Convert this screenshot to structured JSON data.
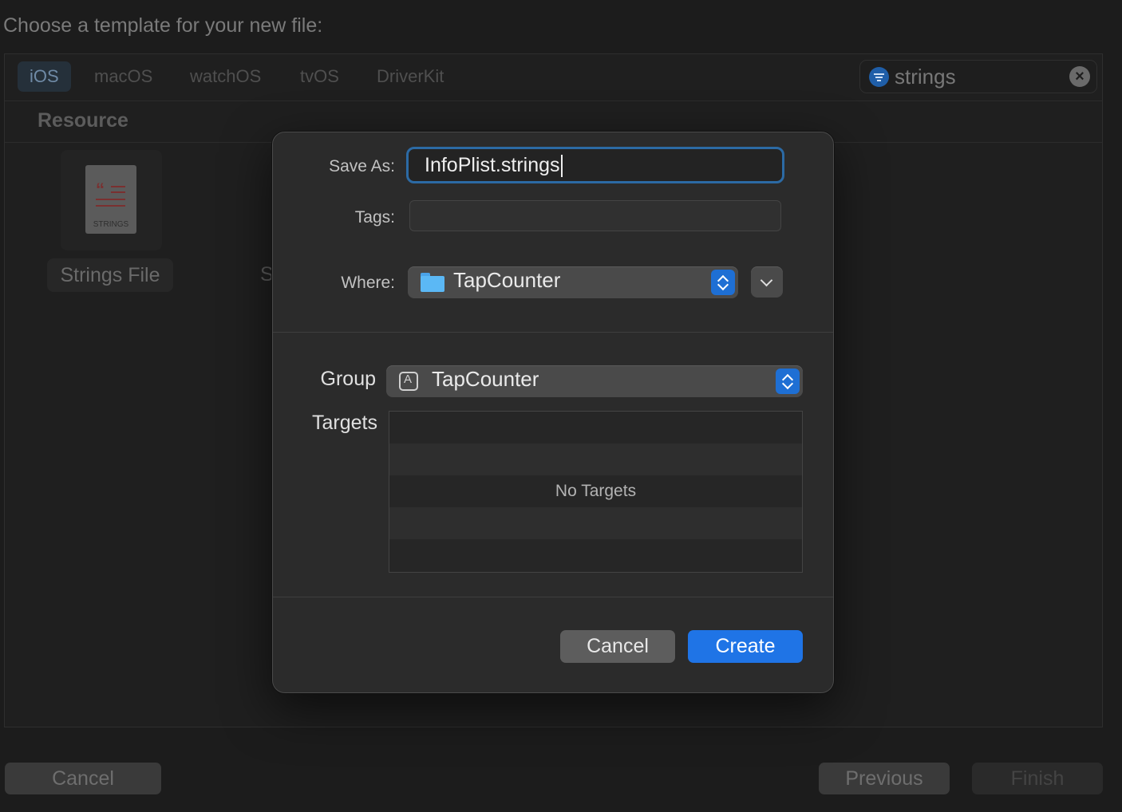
{
  "wizard": {
    "title": "Choose a template for your new file:",
    "platform_tabs": [
      {
        "label": "iOS",
        "active": true
      },
      {
        "label": "macOS",
        "active": false
      },
      {
        "label": "watchOS",
        "active": false
      },
      {
        "label": "tvOS",
        "active": false
      },
      {
        "label": "DriverKit",
        "active": false
      }
    ],
    "search": {
      "value": "strings",
      "icon": "filter-icon",
      "clear_icon": "clear-icon"
    },
    "section_title": "Resource",
    "templates": [
      {
        "label": "Strings File",
        "icon_caption": "STRINGS",
        "selected": true
      },
      {
        "label": "S",
        "selected": false
      }
    ],
    "buttons": {
      "cancel": "Cancel",
      "previous": "Previous",
      "finish": "Finish"
    }
  },
  "dialog": {
    "save_as_label": "Save As:",
    "save_as_value": "InfoPlist.strings",
    "tags_label": "Tags:",
    "tags_value": "",
    "where_label": "Where:",
    "where_value": "TapCounter",
    "group_label": "Group",
    "group_value": "TapCounter",
    "targets_label": "Targets",
    "targets_empty": "No Targets",
    "cancel_label": "Cancel",
    "create_label": "Create",
    "colors": {
      "accent": "#1f74e6",
      "focus_ring": "#2c6aa4",
      "folder": "#5bb8f5"
    }
  }
}
